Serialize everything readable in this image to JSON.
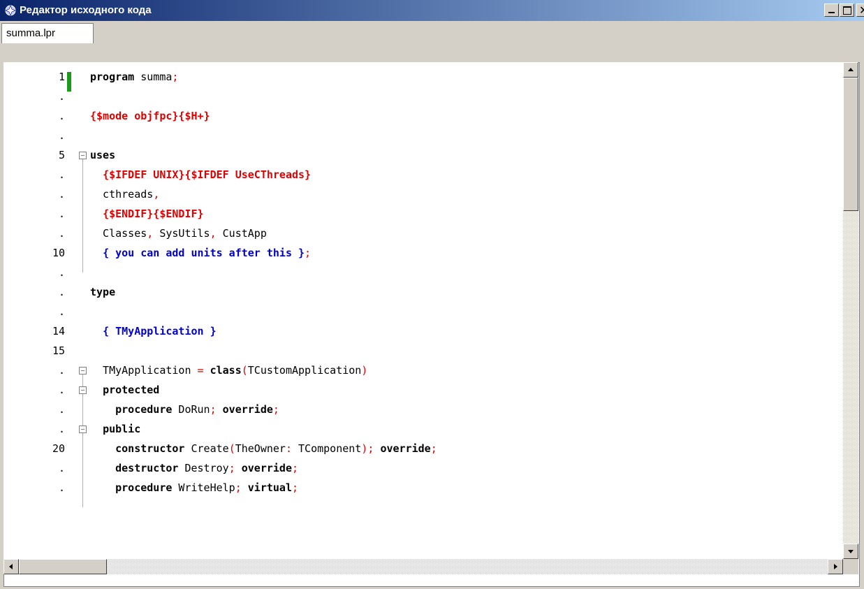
{
  "window": {
    "title": "Редактор исходного кода",
    "min_glyph": "_",
    "max_glyph": "□",
    "close_glyph": "✕"
  },
  "tabs": [
    {
      "label": "summa.lpr",
      "active": true
    }
  ],
  "colors": {
    "keyword": "#000000",
    "directive": "#e00000",
    "symbol": "#e00000",
    "comment": "#0000d0",
    "modified_marker": "#1a9a1a"
  },
  "editor": {
    "lines": [
      {
        "num": "1",
        "tokens": [
          [
            "kw",
            "program"
          ],
          [
            "plain",
            " summa"
          ],
          [
            "sym",
            ";"
          ]
        ]
      },
      {
        "num": ".",
        "tokens": []
      },
      {
        "num": ".",
        "tokens": [
          [
            "dir",
            "{$mode objfpc}{$H+}"
          ]
        ]
      },
      {
        "num": ".",
        "tokens": []
      },
      {
        "num": "5",
        "tokens": [
          [
            "kw",
            "uses"
          ]
        ]
      },
      {
        "num": ".",
        "tokens": [
          [
            "plain",
            "  "
          ],
          [
            "dir",
            "{$IFDEF UNIX}{$IFDEF UseCThreads}"
          ]
        ]
      },
      {
        "num": ".",
        "tokens": [
          [
            "plain",
            "  cthreads"
          ],
          [
            "sym",
            ","
          ]
        ]
      },
      {
        "num": ".",
        "tokens": [
          [
            "plain",
            "  "
          ],
          [
            "dir",
            "{$ENDIF}{$ENDIF}"
          ]
        ]
      },
      {
        "num": ".",
        "tokens": [
          [
            "plain",
            "  Classes"
          ],
          [
            "sym",
            ","
          ],
          [
            "plain",
            " SysUtils"
          ],
          [
            "sym",
            ","
          ],
          [
            "plain",
            " CustApp"
          ]
        ]
      },
      {
        "num": "10",
        "tokens": [
          [
            "plain",
            "  "
          ],
          [
            "cm",
            "{ you can add units after this }"
          ],
          [
            "sym",
            ";"
          ]
        ]
      },
      {
        "num": ".",
        "tokens": []
      },
      {
        "num": ".",
        "tokens": [
          [
            "kw",
            "type"
          ]
        ]
      },
      {
        "num": ".",
        "tokens": []
      },
      {
        "num": "14",
        "tokens": [
          [
            "plain",
            "  "
          ],
          [
            "cm",
            "{ TMyApplication }"
          ]
        ]
      },
      {
        "num": "15",
        "tokens": []
      },
      {
        "num": ".",
        "tokens": [
          [
            "plain",
            "  TMyApplication "
          ],
          [
            "sym",
            "="
          ],
          [
            "plain",
            " "
          ],
          [
            "kw",
            "class"
          ],
          [
            "sym",
            "("
          ],
          [
            "plain",
            "TCustomApplication"
          ],
          [
            "sym",
            ")"
          ]
        ]
      },
      {
        "num": ".",
        "tokens": [
          [
            "plain",
            "  "
          ],
          [
            "kw",
            "protected"
          ]
        ]
      },
      {
        "num": ".",
        "tokens": [
          [
            "plain",
            "    "
          ],
          [
            "kw",
            "procedure"
          ],
          [
            "plain",
            " DoRun"
          ],
          [
            "sym",
            ";"
          ],
          [
            "plain",
            " "
          ],
          [
            "kw",
            "override"
          ],
          [
            "sym",
            ";"
          ]
        ]
      },
      {
        "num": ".",
        "tokens": [
          [
            "plain",
            "  "
          ],
          [
            "kw",
            "public"
          ]
        ]
      },
      {
        "num": "20",
        "tokens": [
          [
            "plain",
            "    "
          ],
          [
            "kw",
            "constructor"
          ],
          [
            "plain",
            " Create"
          ],
          [
            "sym",
            "("
          ],
          [
            "plain",
            "TheOwner"
          ],
          [
            "sym",
            ":"
          ],
          [
            "plain",
            " TComponent"
          ],
          [
            "sym",
            ")"
          ],
          [
            "sym",
            ";"
          ],
          [
            "plain",
            " "
          ],
          [
            "kw",
            "override"
          ],
          [
            "sym",
            ";"
          ]
        ]
      },
      {
        "num": ".",
        "tokens": [
          [
            "plain",
            "    "
          ],
          [
            "kw",
            "destructor"
          ],
          [
            "plain",
            " Destroy"
          ],
          [
            "sym",
            ";"
          ],
          [
            "plain",
            " "
          ],
          [
            "kw",
            "override"
          ],
          [
            "sym",
            ";"
          ]
        ]
      },
      {
        "num": ".",
        "tokens": [
          [
            "plain",
            "    "
          ],
          [
            "kw",
            "procedure"
          ],
          [
            "plain",
            " WriteHelp"
          ],
          [
            "sym",
            ";"
          ],
          [
            "plain",
            " "
          ],
          [
            "kw",
            "virtual"
          ],
          [
            "sym",
            ";"
          ]
        ]
      }
    ]
  }
}
